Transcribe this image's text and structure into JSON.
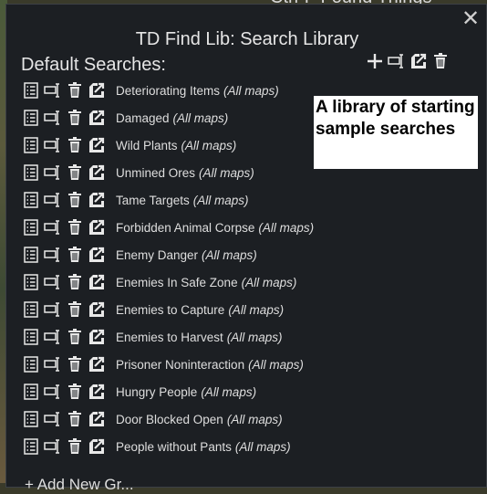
{
  "background": {
    "top_text": "Ctrl-F Found Things"
  },
  "window": {
    "title": "TD Find Lib: Search Library",
    "close_glyph": "✕",
    "section_label": "Default Searches:",
    "header_tools": [
      "plus-icon",
      "rename-icon",
      "export-icon",
      "trash-icon"
    ],
    "searches": [
      {
        "name": "Deteriorating Items",
        "scope": "(All maps)"
      },
      {
        "name": "Damaged",
        "scope": "(All maps)"
      },
      {
        "name": "Wild Plants",
        "scope": "(All maps)"
      },
      {
        "name": "Unmined Ores",
        "scope": "(All maps)"
      },
      {
        "name": "Tame Targets",
        "scope": "(All maps)"
      },
      {
        "name": "Forbidden Animal Corpse",
        "scope": "(All maps)"
      },
      {
        "name": "Enemy Danger",
        "scope": "(All maps)"
      },
      {
        "name": "Enemies In Safe Zone",
        "scope": "(All maps)"
      },
      {
        "name": "Enemies to Capture",
        "scope": "(All maps)"
      },
      {
        "name": "Enemies to Harvest",
        "scope": "(All maps)"
      },
      {
        "name": "Prisoner Noninteraction",
        "scope": "(All maps)"
      },
      {
        "name": "Hungry People",
        "scope": "(All maps)"
      },
      {
        "name": "Door Blocked Open",
        "scope": "(All maps)"
      },
      {
        "name": "People without Pants",
        "scope": "(All maps)"
      }
    ],
    "add_new_label": "Add New Gr..."
  },
  "annotation": {
    "text": "A library of starting sample searches"
  },
  "colors": {
    "window_bg": "#1c1f23",
    "text": "#dedede",
    "icon": "#e8e8e8"
  }
}
